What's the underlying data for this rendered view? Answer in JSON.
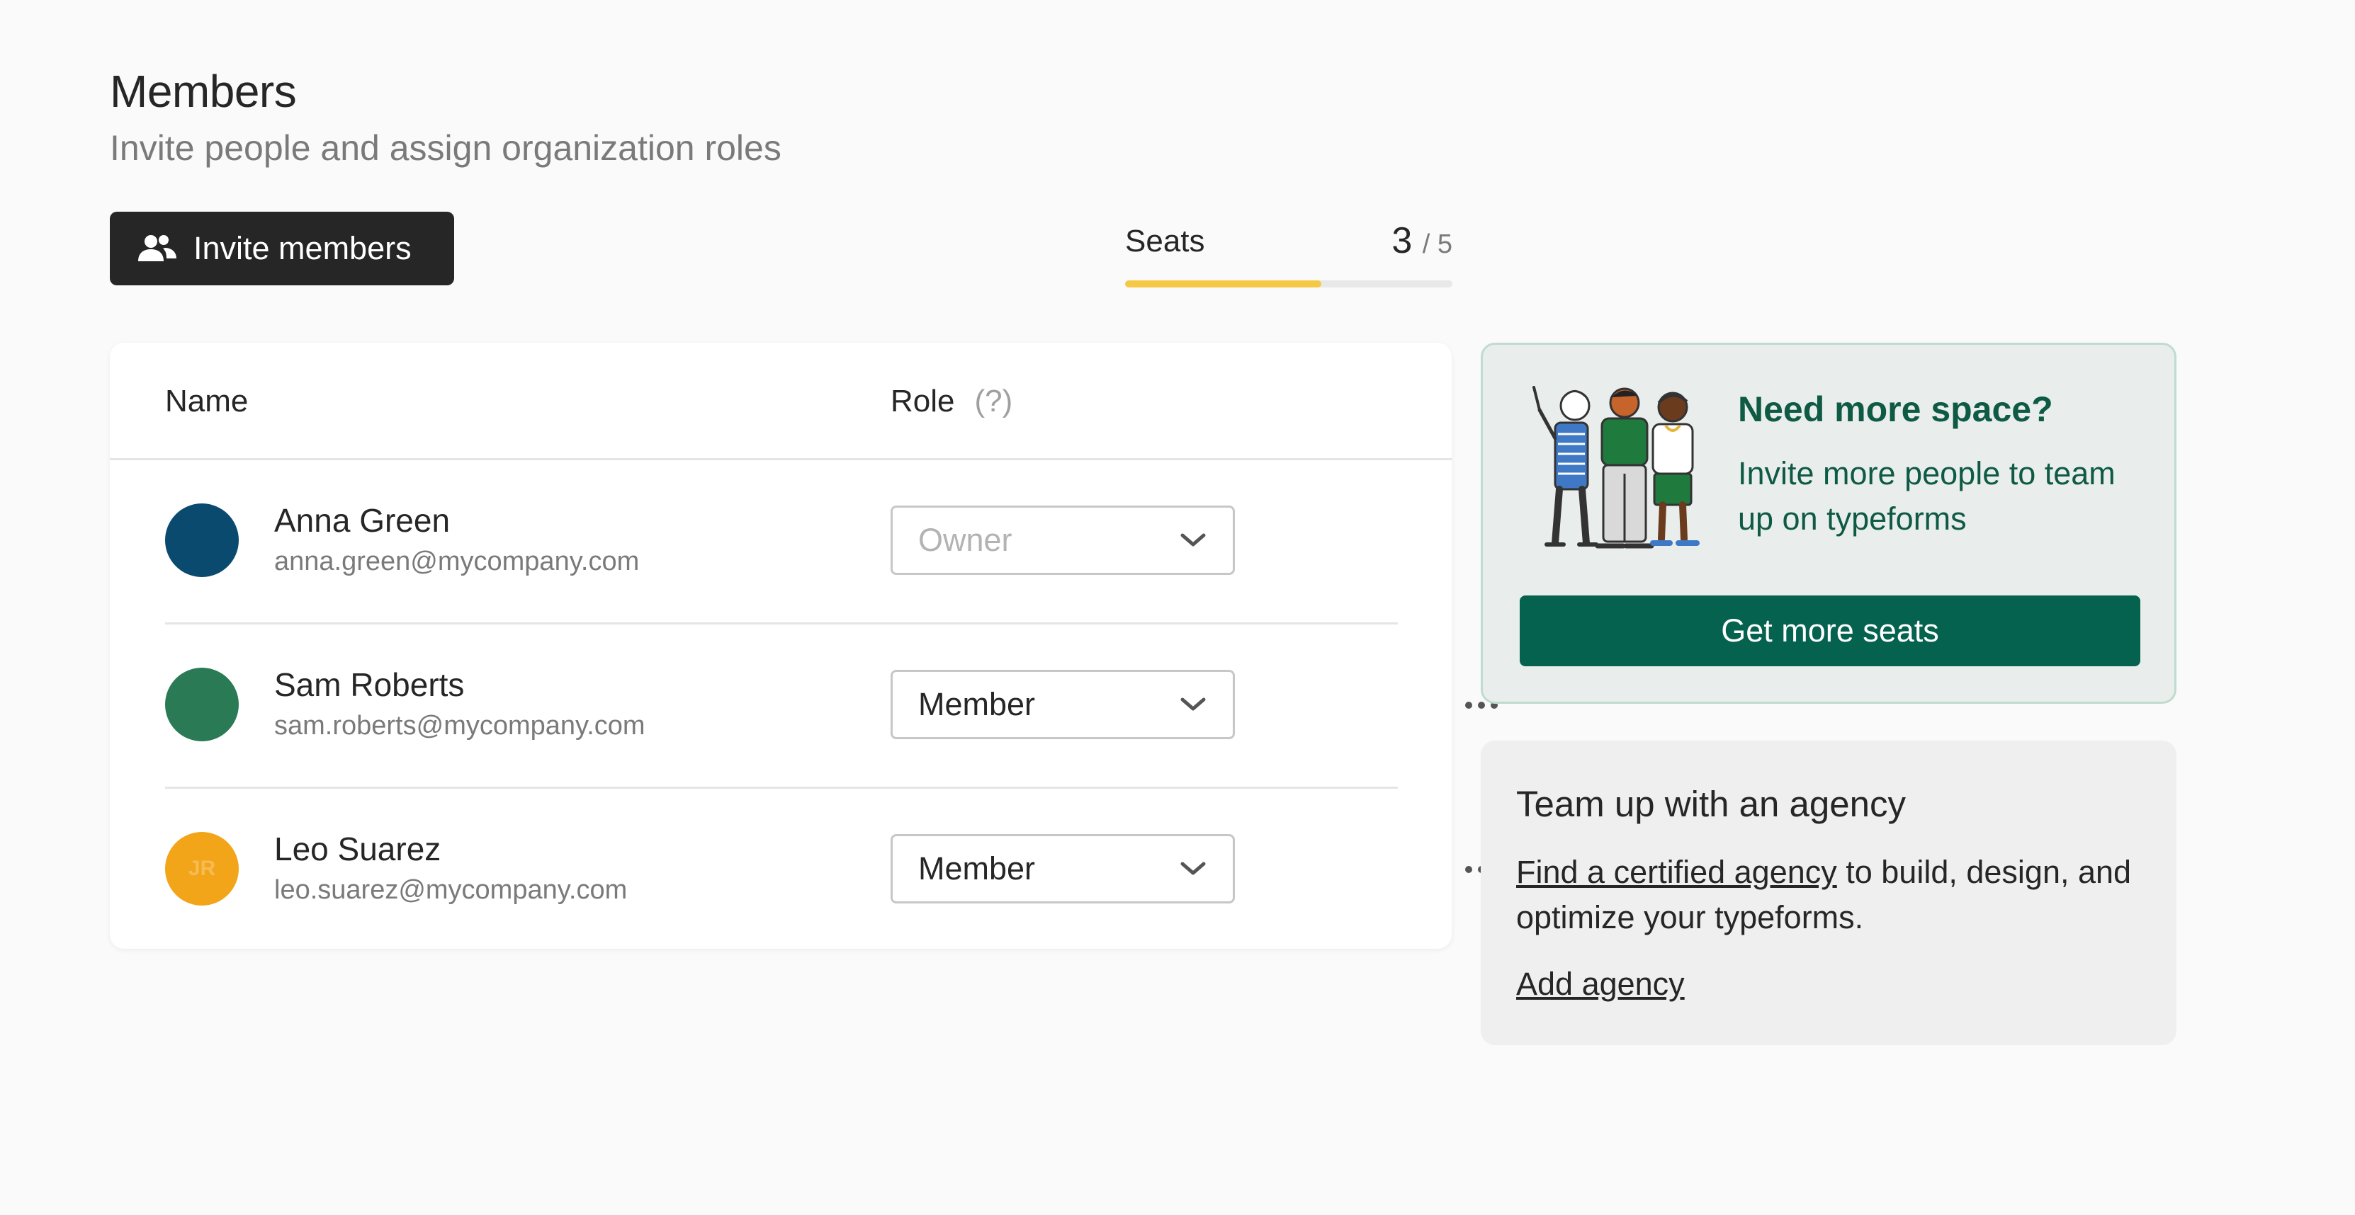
{
  "header": {
    "title": "Members",
    "subtitle": "Invite people and assign organization roles"
  },
  "toolbar": {
    "invite_label": "Invite members",
    "invite_icon": "user-plus-icon"
  },
  "seats": {
    "label": "Seats",
    "used": "3",
    "total": "/ 5",
    "fraction_used": 0.6,
    "bar_color": "#f5c945"
  },
  "table": {
    "col_name": "Name",
    "col_role": "Role",
    "role_help": "(?)",
    "rows": [
      {
        "name": "Anna Green",
        "email": "anna.green@mycompany.com",
        "role": "Owner",
        "avatar_color": "#0b4a6f",
        "avatar_initials": "",
        "role_disabled": true
      },
      {
        "name": "Sam Roberts",
        "email": "sam.roberts@mycompany.com",
        "role": "Member",
        "avatar_color": "#2a7a56",
        "avatar_initials": "",
        "role_disabled": false
      },
      {
        "name": "Leo Suarez",
        "email": "leo.suarez@mycompany.com",
        "role": "Member",
        "avatar_color": "#f3a51a",
        "avatar_initials": "JR",
        "role_disabled": false
      }
    ]
  },
  "promo": {
    "title": "Need more space?",
    "body": "Invite more people to team up on typeforms",
    "button": "Get more seats",
    "accent": "#04624f"
  },
  "agency": {
    "title": "Team up with an agency",
    "link": "Find a certified agency",
    "body_rest": " to build, design, and optimize your typeforms.",
    "add": "Add agency"
  }
}
